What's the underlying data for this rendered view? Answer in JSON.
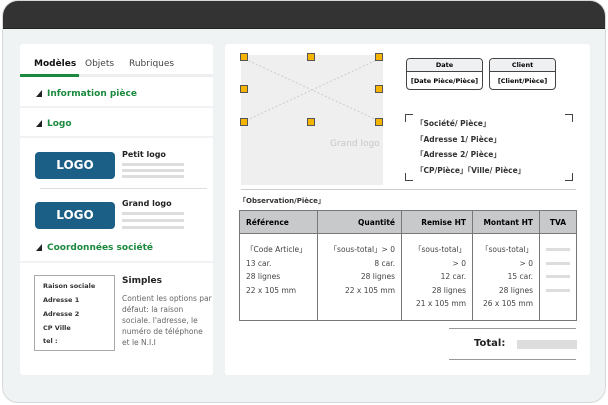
{
  "tabs": [
    {
      "label": "Modèles",
      "active": true
    },
    {
      "label": "Objets"
    },
    {
      "label": "Rubriques"
    }
  ],
  "sections": {
    "info": "Information pièce",
    "logo": "Logo",
    "coord": "Coordonnées société"
  },
  "logos": [
    {
      "button": "LOGO",
      "label": "Petit logo"
    },
    {
      "button": "LOGO",
      "label": "Grand logo"
    }
  ],
  "company_template": {
    "lines": [
      "Raison sociale",
      "Adresse 1",
      "Adresse 2",
      "CP Ville",
      "tel :"
    ],
    "title": "Simples",
    "description": "Contient les options par défaut: la raison sociale. l'adresse, le numéro de téléphone et le N.I.I"
  },
  "preview": {
    "logo_placeholder": "Grand logo",
    "date": {
      "header": "Date",
      "value": "[Date Pièce/Pièce]"
    },
    "client": {
      "header": "Client",
      "value": "[Client/Pièce]"
    },
    "address": [
      "「Société/ Pièce」",
      "「Adresse 1/ Pièce」",
      "「Adresse 2/ Pièce」",
      "「CP/Pièce」「Ville/ Pièce」"
    ],
    "observation": "「Observation/Pièce」",
    "table": {
      "headers": [
        "Référence",
        "Quantité",
        "Remise HT",
        "Montant HT",
        "TVA"
      ],
      "cols": [
        [
          "「Code Article」",
          "13 car.",
          "28 lignes",
          "22 x 105 mm"
        ],
        [
          "「sous-total」> 0",
          "8 car.",
          "28 lignes",
          "22 x 105 mm"
        ],
        [
          "「sous-total」> 0",
          "12 car.",
          "28 lignes",
          "21 x 105 mm"
        ],
        [
          "「sous-total」> 0",
          "15 car.",
          "28 lignes",
          "26 x 105 mm"
        ]
      ]
    },
    "total_label": "Total:"
  },
  "colors": {
    "accent": "#1b8a3e",
    "logo": "#1c5f86",
    "handle": "#f5b400",
    "titlebar": "#333333"
  }
}
